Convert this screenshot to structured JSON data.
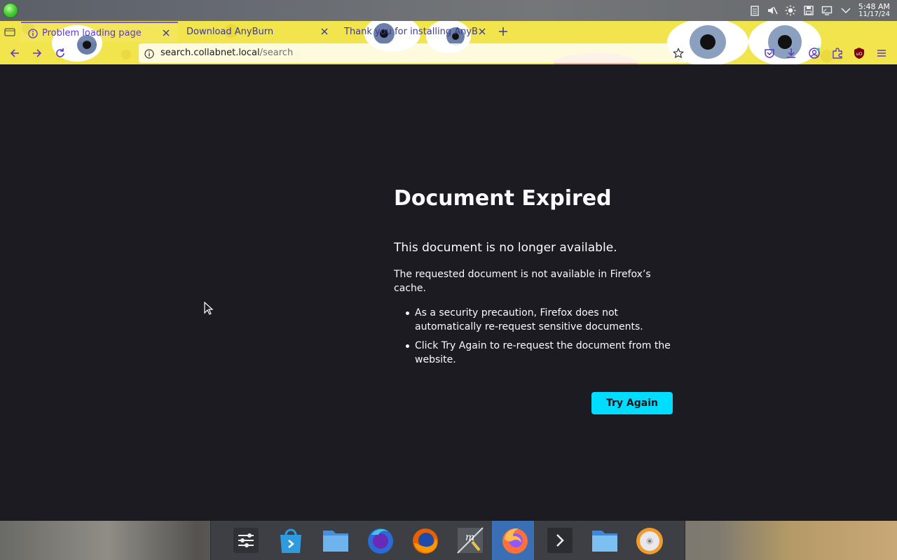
{
  "system_panel": {
    "clock_time": "5:48 AM",
    "clock_date": "11/17/24",
    "tray_icons": [
      "clipboard-icon",
      "volume-muted-icon",
      "brightness-icon",
      "save-icon",
      "display-icon",
      "chevron-down-icon"
    ]
  },
  "browser": {
    "tabs": [
      {
        "title": "Problem loading page",
        "active": true
      },
      {
        "title": "Download AnyBurn",
        "active": false
      },
      {
        "title": "Thank you for installing AnyB",
        "active": false
      }
    ],
    "url": {
      "host": "search.collabnet.local",
      "path": "/search"
    },
    "toolbar_icons": [
      "pocket-icon",
      "downloads-icon",
      "account-icon",
      "extensions-icon",
      "ublock-icon",
      "menu-icon"
    ]
  },
  "error_page": {
    "title": "Document Expired",
    "subtitle": "This document is no longer available.",
    "description": "The requested document is not available in Firefox’s cache.",
    "bullets": [
      "As a security precaution, Firefox does not automatically re-request sensitive documents.",
      "Click Try Again to re-request the document from the website."
    ],
    "button_label": "Try Again"
  },
  "dock": {
    "items": [
      "settings-icon",
      "app-store-icon",
      "file-manager-icon",
      "firefox-nightly-icon",
      "firefox-classic-icon",
      "text-editor-icon",
      "firefox-icon",
      "terminal-icon",
      "folder-icon",
      "disc-burner-icon"
    ],
    "active_index": 6
  },
  "colors": {
    "accent": "#00ddff",
    "page_bg": "#1c1b22",
    "tab_active_text": "#5a39c9"
  }
}
